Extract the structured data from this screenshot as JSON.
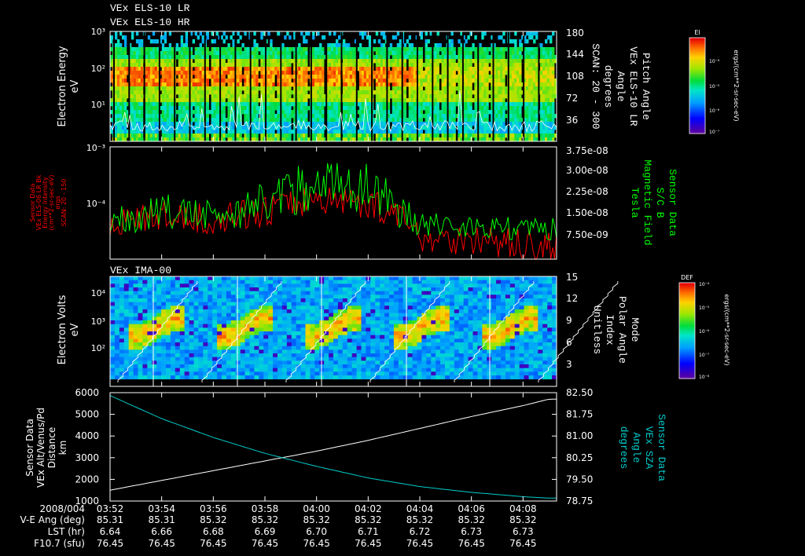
{
  "header": {
    "titles": [
      "VEx ELS-10 LR",
      "VEx ELS-10 HR"
    ]
  },
  "panels": {
    "p1": {
      "ylabel": [
        "Electron Energy",
        "eV"
      ],
      "yticks": [
        "10³",
        "10²",
        "10¹"
      ],
      "right_ticks": [
        "180",
        "144",
        "108",
        "72",
        "36"
      ],
      "right_label": [
        "Pitch Angle",
        "VEx ELS-10 LR",
        "Angle",
        "degrees",
        "SCAN: 20 - 300"
      ],
      "colorbar_title": "El",
      "colorbar_ticks": [
        "10⁻⁴",
        "10⁻⁵",
        "10⁻⁶",
        "10⁻⁷"
      ],
      "colorbar_units": "ergs/(cm**2-sr-sec-eV)"
    },
    "p2": {
      "ylabel": [
        "Sensor Data",
        "VEx ELS-06 LR Bk",
        "Energy Intensity",
        "(cm**2-sr-sec-eV)",
        "ergs",
        "SCAN: 20 - 150"
      ],
      "yticks": [
        "10⁻³",
        "10⁻⁴"
      ],
      "right_ticks": [
        "3.75e-08",
        "3.00e-08",
        "2.25e-08",
        "1.50e-08",
        "7.50e-09"
      ],
      "right_label": [
        "Sensor Data",
        "S/C B",
        "Magnetic Field",
        "Tesla"
      ]
    },
    "p3": {
      "title": "VEx IMA-00",
      "ylabel": [
        "Electron Volts",
        "eV"
      ],
      "yticks": [
        "10⁴",
        "10³",
        "10²"
      ],
      "right_ticks": [
        "15",
        "12",
        "9",
        "6",
        "3"
      ],
      "right_label": [
        "Mode",
        "Polar Angle",
        "Index",
        "Unitless"
      ],
      "colorbar_title": "DEF",
      "colorbar_ticks": [
        "10⁻⁴",
        "10⁻⁵",
        "10⁻⁶",
        "10⁻⁷",
        "10⁻⁸"
      ],
      "colorbar_units": "ergs/(cm**2-sr-sec-eV)"
    },
    "p4": {
      "ylabel": [
        "Sensor Data",
        "VEx Alt/Venus/Pd",
        "Distance",
        "km"
      ],
      "yticks": [
        "6000",
        "5000",
        "4000",
        "3000",
        "2000",
        "1000"
      ],
      "right_ticks": [
        "82.50",
        "81.75",
        "81.00",
        "80.25",
        "79.50",
        "78.75"
      ],
      "right_label": [
        "Sensor Data",
        "VEx SZA",
        "Angle",
        "degrees"
      ]
    }
  },
  "footer": {
    "row_labels": [
      "2008/004",
      "V-E Ang (deg)",
      "LST (hr)",
      "F10.7 (sfu)"
    ],
    "times": [
      "03:52",
      "03:54",
      "03:56",
      "03:58",
      "04:00",
      "04:02",
      "04:04",
      "04:06",
      "04:08"
    ],
    "ve_ang": [
      "85.31",
      "85.31",
      "85.32",
      "85.32",
      "85.32",
      "85.32",
      "85.32",
      "85.32",
      "85.32"
    ],
    "lst": [
      "6.64",
      "6.66",
      "6.68",
      "6.69",
      "6.70",
      "6.71",
      "6.72",
      "6.73",
      "6.73"
    ],
    "f107": [
      "76.45",
      "76.45",
      "76.45",
      "76.45",
      "76.45",
      "76.45",
      "76.45",
      "76.45",
      "76.45"
    ]
  },
  "colors": {
    "background": "#000000",
    "axes": "#ffffff",
    "els_flux": "#ff0000",
    "mag_field": "#00ff00",
    "sza": "#00cccc",
    "altitude": "#ffffff"
  },
  "chart_data": [
    {
      "type": "heatmap",
      "title": "VEx ELS-10 LR",
      "ylabel": "Electron Energy (eV)",
      "yscale": "log",
      "ylim": [
        1,
        1000
      ],
      "x_time_range": [
        "03:52",
        "04:09"
      ],
      "peak_energy_band_eV": [
        40,
        100
      ],
      "right_axis": {
        "label": "Pitch Angle (degrees)",
        "ylim": [
          0,
          180
        ]
      }
    },
    {
      "type": "line",
      "series": [
        {
          "name": "VEx ELS-06 LR Bk",
          "axis": "left",
          "yscale": "log",
          "x": [
            "03:52",
            "03:54",
            "03:56",
            "03:58",
            "04:00",
            "04:02",
            "04:04",
            "04:06",
            "04:08",
            "04:09"
          ],
          "values": [
            4.5e-05,
            6e-05,
            5e-05,
            7e-05,
            0.00012,
            0.0001,
            2.5e-05,
            2.2e-05,
            1.8e-05,
            1.6e-05
          ]
        },
        {
          "name": "S/C B",
          "axis": "right",
          "x": [
            "03:52",
            "03:54",
            "03:56",
            "03:58",
            "04:00",
            "04:02",
            "04:04",
            "04:06",
            "04:08",
            "04:09"
          ],
          "values": [
            1.2e-08,
            1.6e-08,
            1.4e-08,
            1.9e-08,
            2.6e-08,
            2.4e-08,
            1.2e-08,
            1.1e-08,
            1e-08,
            1e-08
          ]
        }
      ],
      "left_ylim": [
        1e-05,
        0.001
      ],
      "right_ylim": [
        0,
        3.75e-08
      ]
    },
    {
      "type": "heatmap",
      "title": "VEx IMA-00",
      "ylabel": "Electron Volts (eV)",
      "yscale": "log",
      "ylim": [
        10,
        30000
      ],
      "x_time_range": [
        "03:52",
        "04:09"
      ],
      "right_axis": {
        "label": "Polar Angle Index",
        "ylim": [
          0,
          15
        ]
      }
    },
    {
      "type": "line",
      "x": [
        "03:52",
        "03:54",
        "03:56",
        "03:58",
        "04:00",
        "04:02",
        "04:04",
        "04:06",
        "04:08",
        "04:09"
      ],
      "series": [
        {
          "name": "VEx Alt/Venus/Pd",
          "axis": "left",
          "values": [
            1500,
            1950,
            2400,
            2850,
            3300,
            3800,
            4350,
            4900,
            5400,
            5700
          ]
        },
        {
          "name": "VEx SZA",
          "axis": "right",
          "values": [
            82.4,
            81.6,
            80.95,
            80.4,
            79.95,
            79.55,
            79.25,
            79.05,
            78.9,
            78.85
          ]
        }
      ],
      "left_ylim": [
        1000,
        6000
      ],
      "right_ylim": [
        78.75,
        82.5
      ]
    }
  ]
}
